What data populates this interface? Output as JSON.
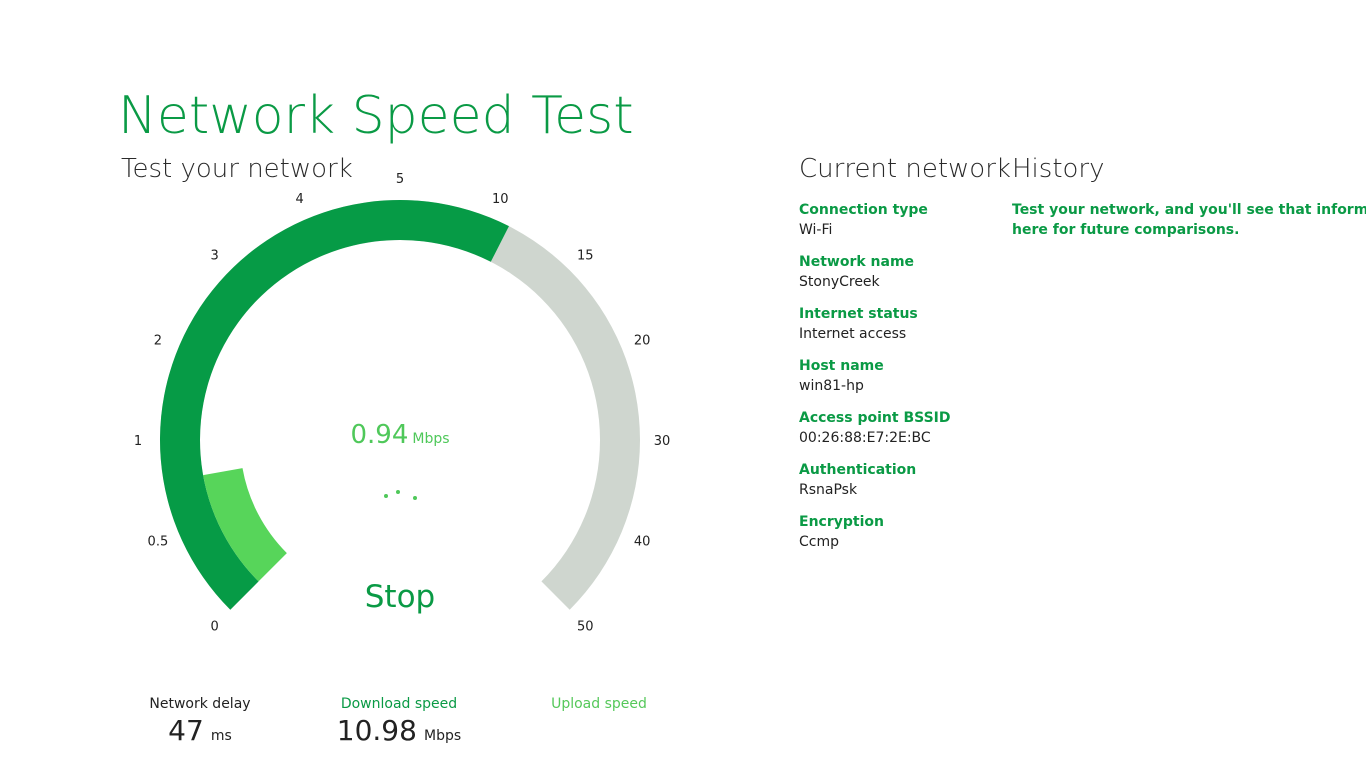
{
  "app": {
    "title": "Network Speed Test"
  },
  "test": {
    "section_title": "Test your network",
    "current_speed": {
      "value": "0.94",
      "unit": "Mbps"
    },
    "stop_label": "Stop",
    "gauge": {
      "tick_labels": [
        "0",
        "0.5",
        "1",
        "2",
        "3",
        "4",
        "5",
        "10",
        "15",
        "20",
        "30",
        "40",
        "50"
      ],
      "max_tick_index": 12,
      "progress_tick_index": 7.2,
      "current_tick_index": 1.55,
      "colors": {
        "progress": "#069b46",
        "current": "#57d55a",
        "track": "#cfd6cf"
      }
    },
    "metrics": {
      "delay": {
        "label": "Network delay",
        "value": "47",
        "unit": "ms",
        "label_color": "#222222"
      },
      "download": {
        "label": "Download speed",
        "value": "10.98",
        "unit": "Mbps",
        "label_color": "#0a9a45"
      },
      "upload": {
        "label": "Upload speed",
        "value": "",
        "unit": "",
        "label_color": "#55c85a"
      }
    }
  },
  "current_network": {
    "section_title": "Current network",
    "items": [
      {
        "label": "Connection type",
        "value": "Wi-Fi"
      },
      {
        "label": "Network name",
        "value": "StonyCreek"
      },
      {
        "label": "Internet status",
        "value": "Internet access"
      },
      {
        "label": "Host name",
        "value": "win81-hp"
      },
      {
        "label": "Access point BSSID",
        "value": "00:26:88:E7:2E:BC"
      },
      {
        "label": "Authentication",
        "value": "RsnaPsk"
      },
      {
        "label": "Encryption",
        "value": "Ccmp"
      }
    ]
  },
  "history": {
    "section_title": "History",
    "message_line1": "Test your network, and you'll see that information stored",
    "message_line2": "here for future comparisons."
  }
}
